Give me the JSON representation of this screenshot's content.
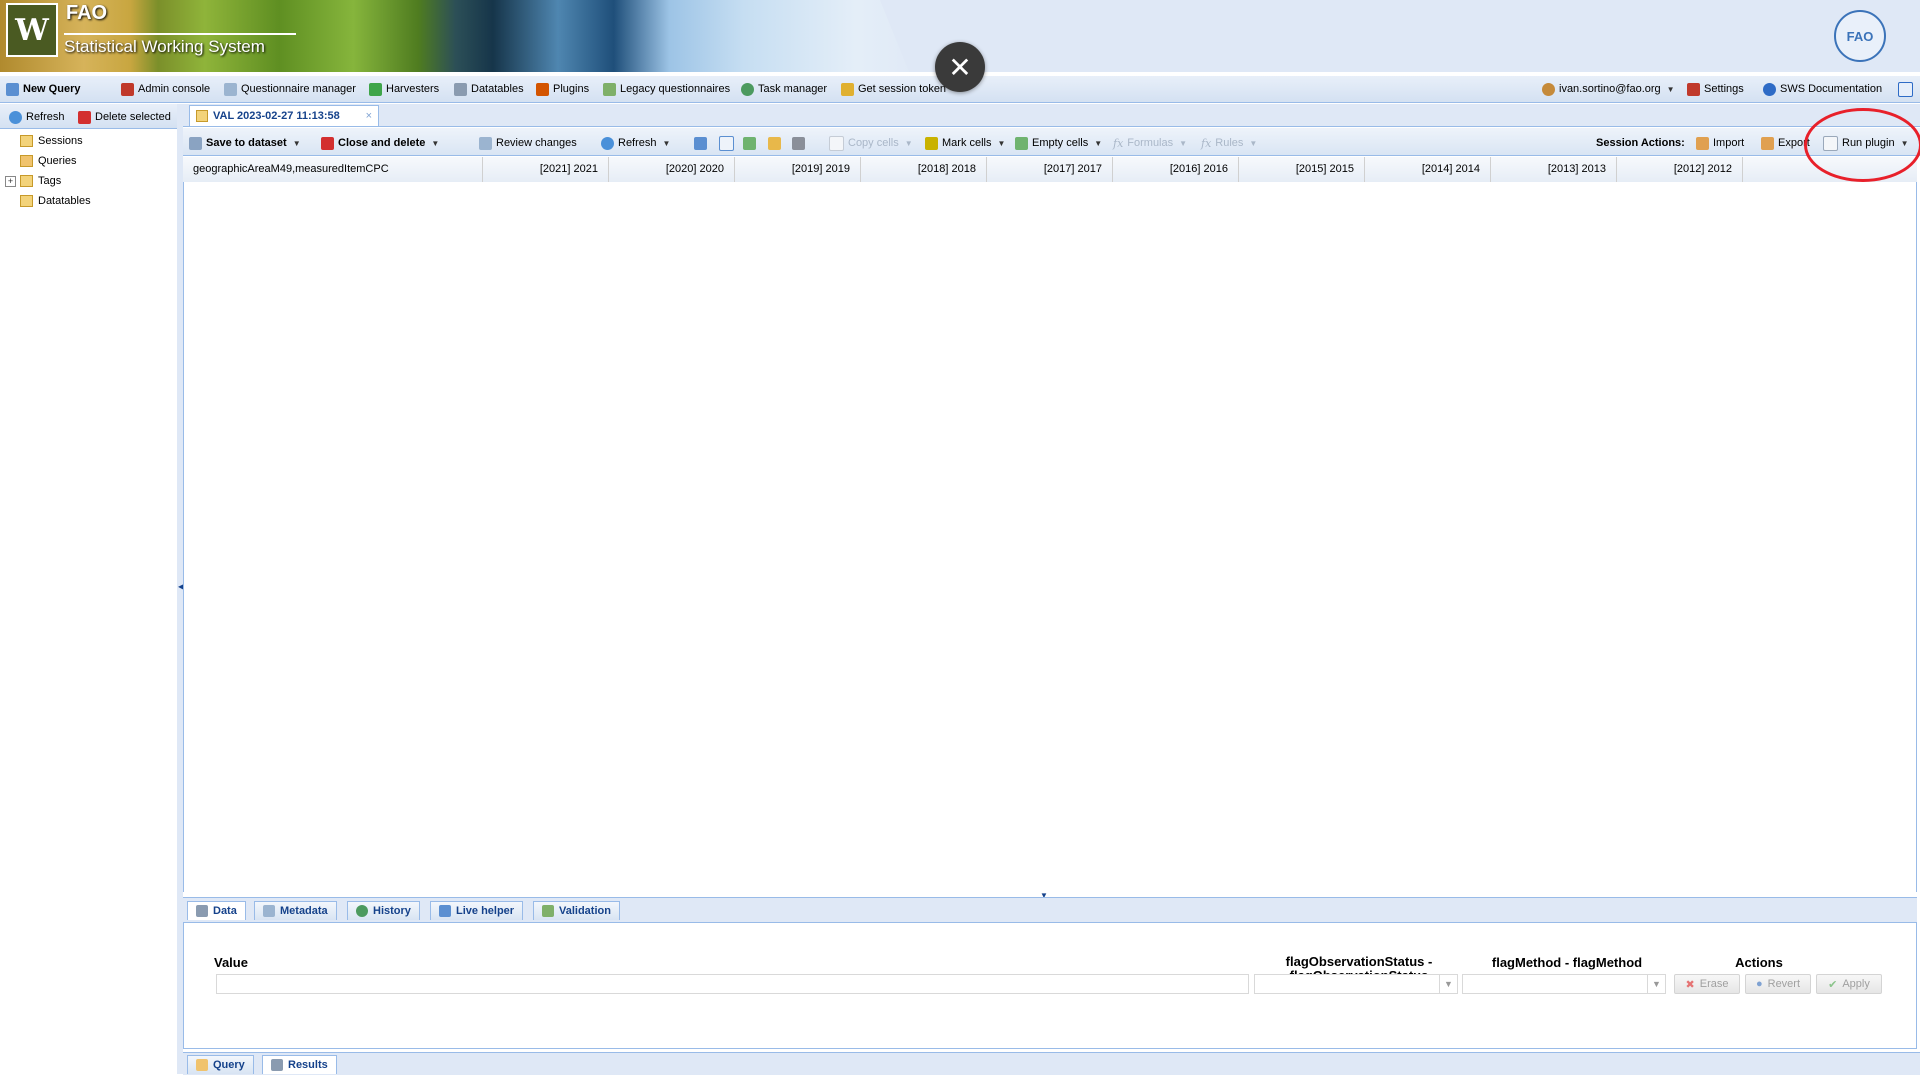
{
  "banner": {
    "logo_text": "W",
    "brand_line1": "FAO",
    "brand_line2": "Statistical Working System",
    "seal_text": "FAO"
  },
  "overlay": {
    "close_glyph": "✕"
  },
  "main_toolbar": {
    "new_query": "New Query",
    "admin_console": "Admin console",
    "questionnaire_manager": "Questionnaire manager",
    "harvesters": "Harvesters",
    "datatables": "Datatables",
    "plugins": "Plugins",
    "legacy_questionnaires": "Legacy questionnaires",
    "task_manager": "Task manager",
    "get_session_token": "Get session token",
    "user": "ivan.sortino@fao.org",
    "settings": "Settings",
    "sws_documentation": "SWS Documentation"
  },
  "left_panel": {
    "refresh": "Refresh",
    "delete_selected": "Delete selected",
    "tree": [
      "Sessions",
      "Queries",
      "Tags",
      "Datatables"
    ]
  },
  "session_tab": {
    "title": "VAL 2023-02-27 11:13:58",
    "close": "×"
  },
  "session_toolbar": {
    "save_to_dataset": "Save to dataset",
    "close_and_delete": "Close and delete",
    "review_changes": "Review changes",
    "refresh": "Refresh",
    "copy_cells": "Copy cells",
    "mark_cells": "Mark cells",
    "empty_cells": "Empty cells",
    "formulas": "Formulas",
    "rules": "Rules",
    "session_actions": "Session Actions:",
    "import": "Import",
    "export": "Export",
    "run_plugin": "Run plugin"
  },
  "grid": {
    "first_column": "geographicAreaM49,measuredItemCPC",
    "columns": [
      "[2021] 2021",
      "[2020] 2020",
      "[2019] 2019",
      "[2018] 2018",
      "[2017] 2017",
      "[2016] 2016",
      "[2015] 2015",
      "[2014] 2014",
      "[2013] 2013",
      "[2012] 2012"
    ]
  },
  "bottom_tabs": [
    "Data",
    "Metadata",
    "History",
    "Live helper",
    "Validation"
  ],
  "edit_panel": {
    "value_label": "Value",
    "flag_obs_label_1": "flagObservationStatus -",
    "flag_obs_label_2": "flagObservationStatus",
    "flag_method_label": "flagMethod - flagMethod",
    "actions_label": "Actions",
    "erase": "Erase",
    "revert": "Revert",
    "apply": "Apply"
  },
  "footer_tabs": [
    "Query",
    "Results"
  ],
  "colors": {
    "accent": "#15428b",
    "panel_border": "#99bbe8",
    "highlight": "#e8202a"
  }
}
